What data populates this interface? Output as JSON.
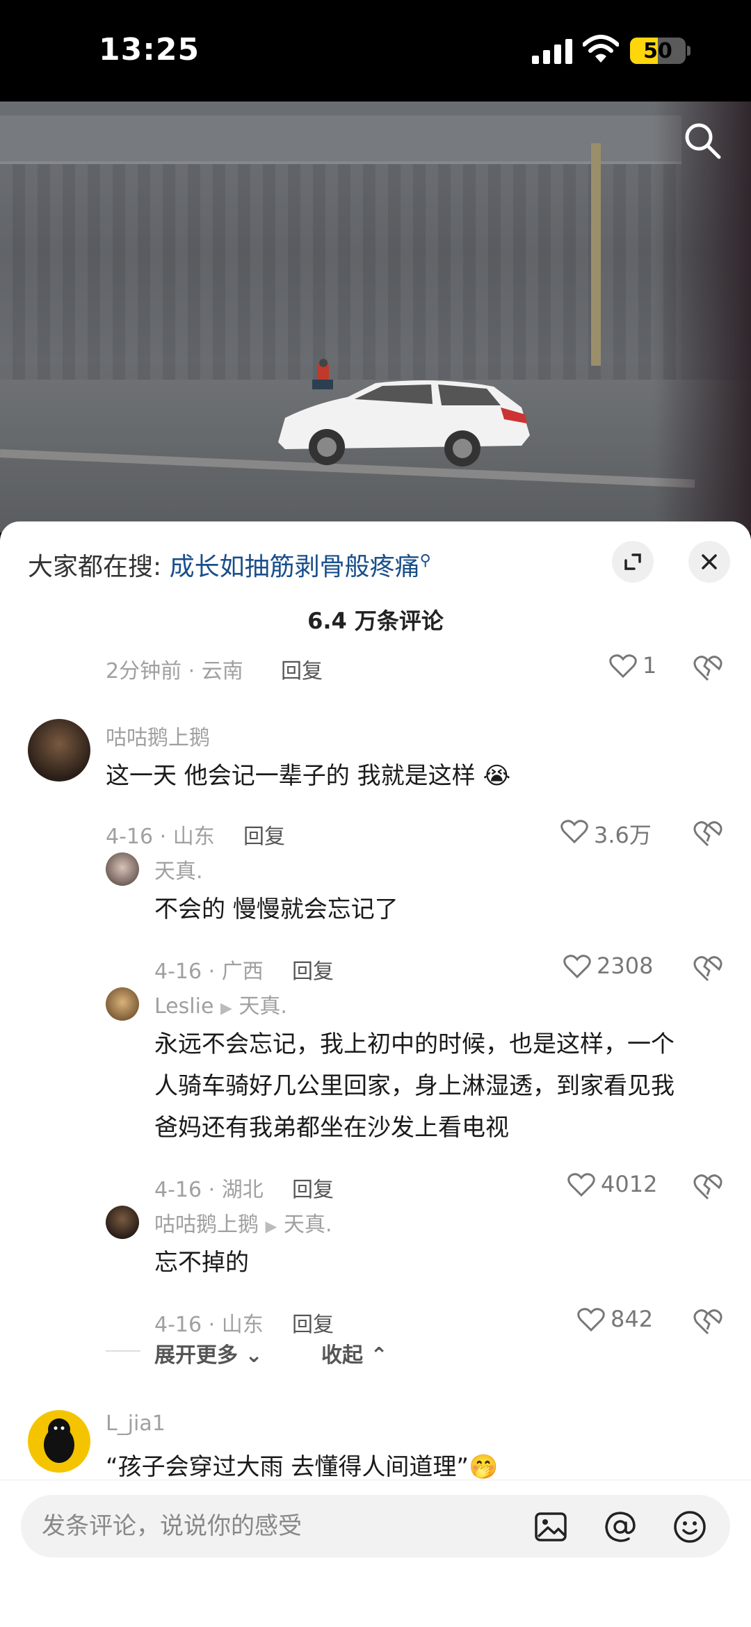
{
  "status_bar": {
    "time": "13:25",
    "battery": "50",
    "battery_level": 0.5
  },
  "hot_search": {
    "prefix": "大家都在搜:",
    "term": "成长如抽筋剥骨般疼痛"
  },
  "comments_title": "6.4 万条评论",
  "partial_comment": {
    "meta": "2分钟前 · 云南",
    "reply": "回复",
    "likes": "1"
  },
  "comments": [
    {
      "user": "咕咕鹅上鹅",
      "text": "这一天 他会记一辈子的 我就是这样",
      "meta": "4-16 · 山东",
      "reply": "回复",
      "likes": "3.6万"
    },
    {
      "user": "天真.",
      "text": "不会的 慢慢就会忘记了",
      "meta": "4-16 · 广西",
      "reply": "回复",
      "likes": "2308"
    },
    {
      "user": "Leslie",
      "reply_to": "天真.",
      "text_lines": [
        "永远不会忘记，我上初中的时候，也是这样，一个",
        "人骑车骑好几公里回家，身上淋湿透，到家看见我",
        "爸妈还有我弟都坐在沙发上看电视"
      ],
      "meta": "4-16 · 湖北",
      "reply": "回复",
      "likes": "4012"
    },
    {
      "user": "咕咕鹅上鹅",
      "reply_to": "天真.",
      "text": "忘不掉的",
      "meta": "4-16 · 山东",
      "reply": "回复",
      "likes": "842"
    },
    {
      "user": "L_jia1",
      "text": "“孩子会穿过大雨 去懂得人间道理”"
    }
  ],
  "expand_more": "展开更多",
  "collapse": "收起",
  "input": {
    "placeholder": "发条评论，说说你的感受"
  }
}
